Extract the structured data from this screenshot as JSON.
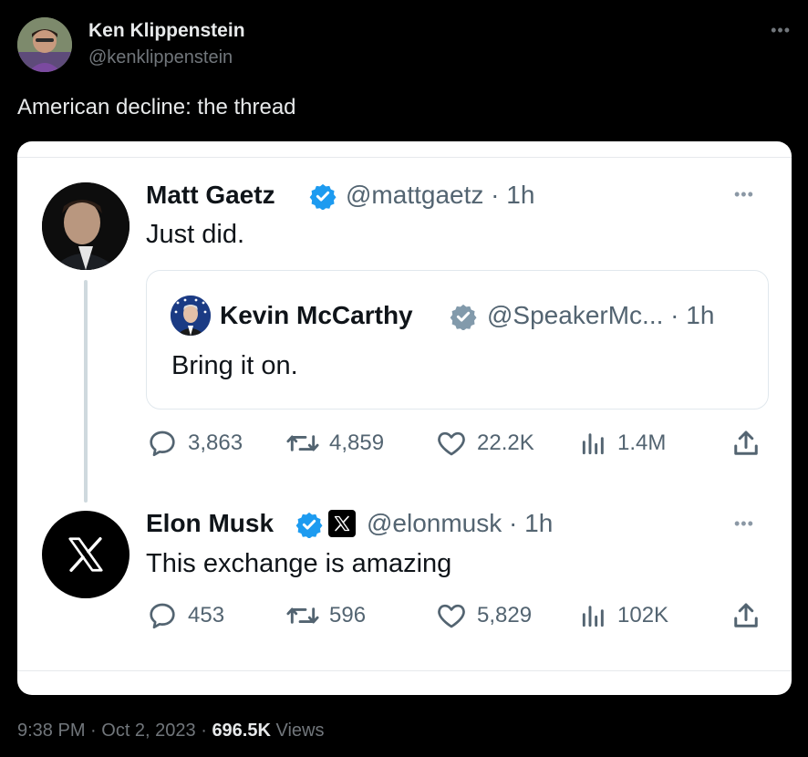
{
  "author": {
    "name": "Ken Klippenstein",
    "handle": "@kenklippenstein"
  },
  "tweet": {
    "text": "American decline: the thread"
  },
  "embedded": {
    "first": {
      "name": "Matt Gaetz",
      "handle_time": "@mattgaetz · 1h",
      "text": "Just did.",
      "quote": {
        "name": "Kevin McCarthy",
        "handle_time": "@SpeakerMc... · 1h",
        "text": "Bring it on."
      },
      "stats": {
        "replies": "3,863",
        "retweets": "4,859",
        "likes": "22.2K",
        "views": "1.4M"
      }
    },
    "second": {
      "name": "Elon Musk",
      "handle_time": "@elonmusk · 1h",
      "text": "This exchange is amazing",
      "stats": {
        "replies": "453",
        "retweets": "596",
        "likes": "5,829",
        "views": "102K"
      }
    }
  },
  "footer": {
    "time": "9:38 PM · Oct 2, 2023 · ",
    "views_count": "696.5K",
    "views_label": " Views"
  },
  "colors": {
    "verified": "#1d9bf0",
    "background": "#000000",
    "card": "#ffffff",
    "muted": "#536471"
  }
}
